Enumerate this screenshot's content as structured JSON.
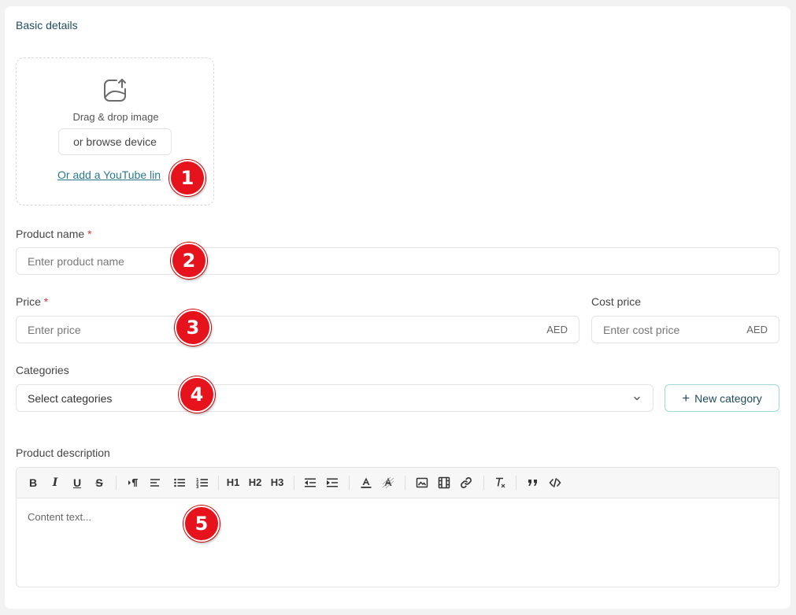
{
  "section": {
    "title": "Basic details"
  },
  "upload": {
    "drag_text": "Drag & drop image",
    "browse_label": "or browse device",
    "youtube_link": "Or add a YouTube lin"
  },
  "product_name": {
    "label": "Product name",
    "required_mark": "*",
    "placeholder": "Enter product name"
  },
  "price": {
    "label": "Price",
    "required_mark": "*",
    "placeholder": "Enter price",
    "currency": "AED"
  },
  "cost_price": {
    "label": "Cost price",
    "placeholder": "Enter cost price",
    "currency": "AED"
  },
  "categories": {
    "label": "Categories",
    "selected": "Select categories",
    "new_button": "New category"
  },
  "description": {
    "label": "Product description",
    "content": "Content text..."
  },
  "toolbar": {
    "bold": "B",
    "italic": "I",
    "underline": "U",
    "strike": "S",
    "h1": "H1",
    "h2": "H2",
    "h3": "H3"
  },
  "badges": [
    "1",
    "2",
    "3",
    "4",
    "5"
  ],
  "colors": {
    "accent": "#2a7a8c",
    "required": "#e03434",
    "badge": "#e6121c"
  }
}
